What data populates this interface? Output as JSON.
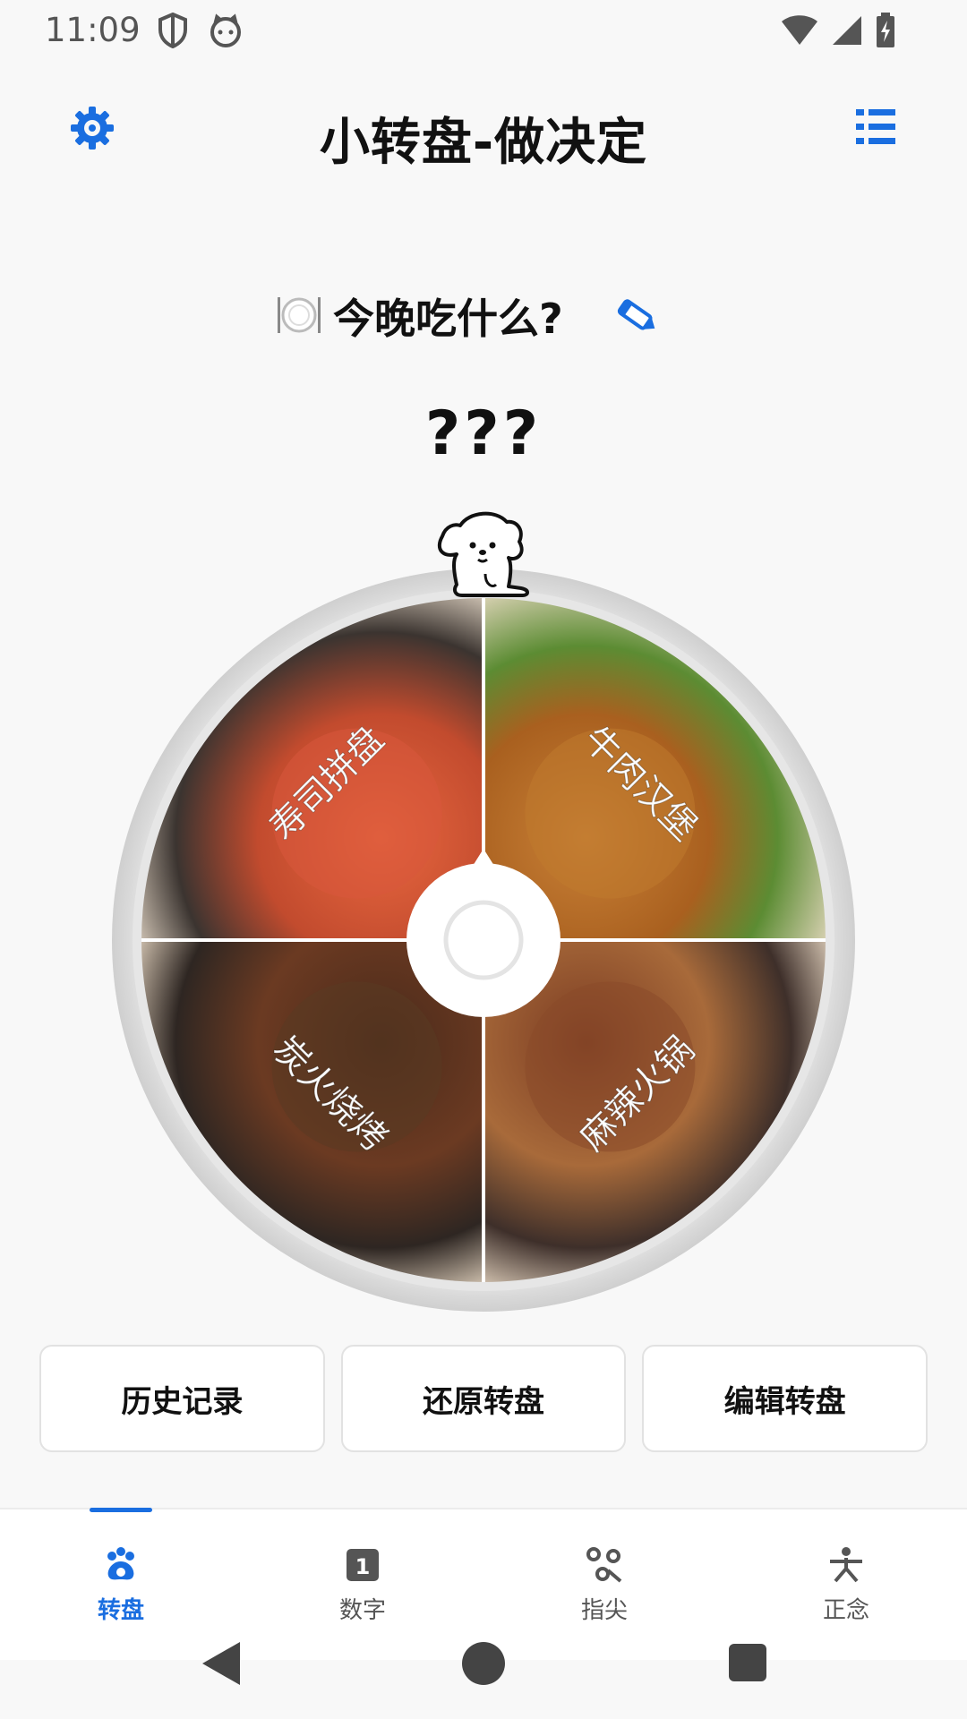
{
  "status_bar": {
    "time": "11:09",
    "icons": [
      "shield-icon",
      "cat-face-icon",
      "wifi-icon",
      "signal-icon",
      "battery-charging-icon"
    ]
  },
  "app_bar": {
    "title": "小转盘-做决定",
    "left_icon": "settings-gear-icon",
    "right_icon": "list-menu-icon",
    "accent_color": "#1a6ee0"
  },
  "question": {
    "emoji_icon": "plate-cutlery-icon",
    "text": "今晚吃什么?",
    "edit_icon": "pencil-icon"
  },
  "result": {
    "text": "???"
  },
  "wheel": {
    "pointer_icon": "dog-mascot-icon",
    "center_icon": "ring-icon",
    "segments": [
      {
        "label": "寿司拼盘",
        "image": "sushi-photo",
        "color": "#d9583c"
      },
      {
        "label": "牛肉汉堡",
        "image": "burger-photo",
        "color": "#c07a2e"
      },
      {
        "label": "麻辣火锅",
        "image": "hotpot-photo",
        "color": "#8a4a2a"
      },
      {
        "label": "炭火烧烤",
        "image": "bbq-photo",
        "color": "#5a3a22"
      }
    ]
  },
  "actions": {
    "history": "历史记录",
    "reset": "还原转盘",
    "edit": "编辑转盘"
  },
  "bottom_nav": {
    "items": [
      {
        "label": "转盘",
        "icon": "paw-icon",
        "active": true
      },
      {
        "label": "数字",
        "icon": "number-one-icon",
        "active": false
      },
      {
        "label": "指尖",
        "icon": "fingertip-icon",
        "active": false
      },
      {
        "label": "正念",
        "icon": "meditation-icon",
        "active": false
      }
    ]
  },
  "system_nav": {
    "icons": [
      "back-icon",
      "home-icon",
      "recents-icon"
    ]
  }
}
